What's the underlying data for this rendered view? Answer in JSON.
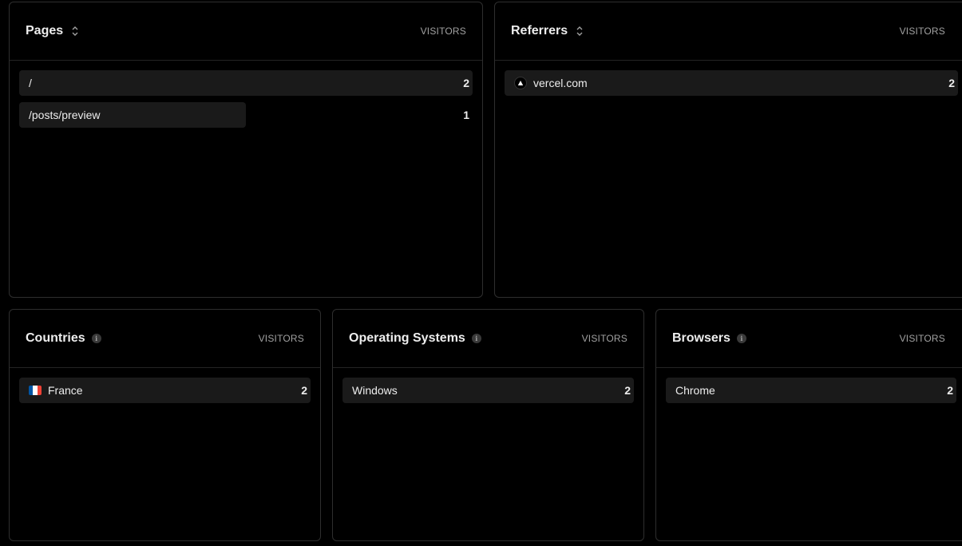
{
  "panels": {
    "pages": {
      "title": "Pages",
      "column": "VISITORS",
      "rows": [
        {
          "label": "/",
          "value": "2",
          "fraction": 1.0
        },
        {
          "label": "/posts/preview",
          "value": "1",
          "fraction": 0.5
        }
      ]
    },
    "referrers": {
      "title": "Referrers",
      "column": "VISITORS",
      "rows": [
        {
          "label": "vercel.com",
          "value": "2",
          "fraction": 1.0,
          "icon": "vercel-triangle-icon"
        }
      ]
    },
    "countries": {
      "title": "Countries",
      "column": "VISITORS",
      "rows": [
        {
          "label": "France",
          "value": "2",
          "fraction": 1.0,
          "icon": "flag-france-icon"
        }
      ]
    },
    "os": {
      "title": "Operating Systems",
      "column": "VISITORS",
      "rows": [
        {
          "label": "Windows",
          "value": "2",
          "fraction": 1.0
        }
      ]
    },
    "browsers": {
      "title": "Browsers",
      "column": "VISITORS",
      "rows": [
        {
          "label": "Chrome",
          "value": "2",
          "fraction": 1.0
        }
      ]
    }
  },
  "colors": {
    "background": "#000000",
    "border": "#2e2e2e",
    "row_bar": "#1a1a1a",
    "text": "#ededed",
    "muted": "#a1a1a1"
  }
}
